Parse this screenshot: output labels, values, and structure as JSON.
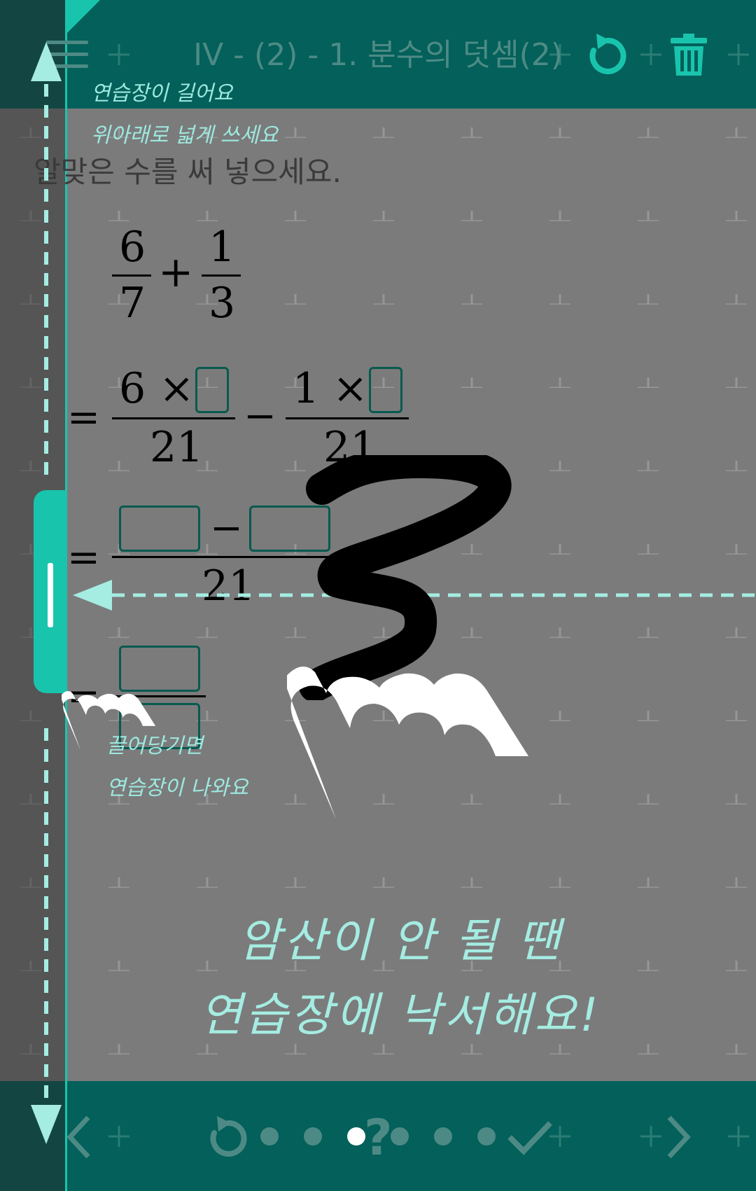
{
  "header": {
    "title": "IV - (2) - 1. 분수의 덧셈(2)",
    "menu_icon": "hamburger-icon",
    "reset_icon": "refresh-icon",
    "delete_icon": "trash-icon"
  },
  "question": {
    "prompt": "알맞은 수를 써 넣으세요.",
    "expression": {
      "frac1": {
        "num": "6",
        "den": "7"
      },
      "plus": "+",
      "frac2": {
        "num": "1",
        "den": "3"
      }
    },
    "step1": {
      "equals": "=",
      "left_num": "6 ×",
      "left_den": "21",
      "operator": "−",
      "right_num": "1 ×",
      "right_den": "21"
    },
    "step2": {
      "equals": "=",
      "operator": "−",
      "den": "21"
    },
    "step3": {
      "equals": "="
    }
  },
  "tutorial": {
    "scroll_hint_line1": "연습장이 길어요",
    "scroll_hint_line2": "위아래로 넓게 쓰세요",
    "pull_hint_line1": "끌어당기면",
    "pull_hint_line2": "연습장이 나와요",
    "big_hint_line1": "암산이 안 될 땐",
    "big_hint_line2": "연습장에 낙서해요!"
  },
  "footer": {
    "prev_icon": "chevron-left-icon",
    "retry_icon": "refresh-icon",
    "help_label": "?",
    "check_icon": "check-icon",
    "next_icon": "chevron-right-icon",
    "pages_total": 6,
    "active_page": 3
  },
  "colors": {
    "header_bg": "#03605a",
    "accent": "#19c4ad",
    "hint_text": "#9de8df",
    "canvas_bg": "#7b7b7b"
  }
}
